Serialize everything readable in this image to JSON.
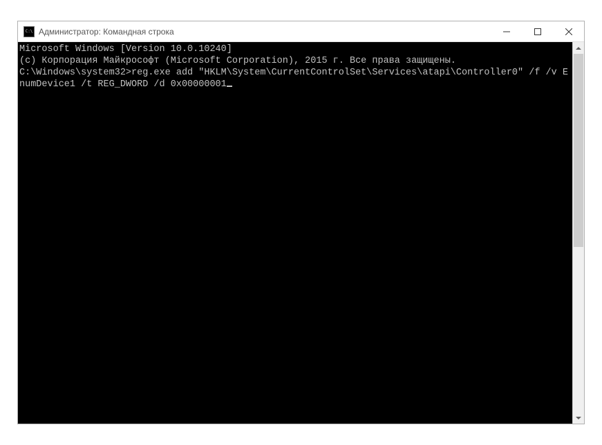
{
  "window": {
    "title": "Администратор: Командная строка"
  },
  "console": {
    "line1": "Microsoft Windows [Version 10.0.10240]",
    "line2": "(c) Корпорация Майкрософт (Microsoft Corporation), 2015 г. Все права защищены.",
    "blank": "",
    "prompt": "C:\\Windows\\system32>",
    "command": "reg.exe add \"HKLM\\System\\CurrentControlSet\\Services\\atapi\\Controller0\" /f /v EnumDevice1 /t REG_DWORD /d 0x00000001"
  }
}
